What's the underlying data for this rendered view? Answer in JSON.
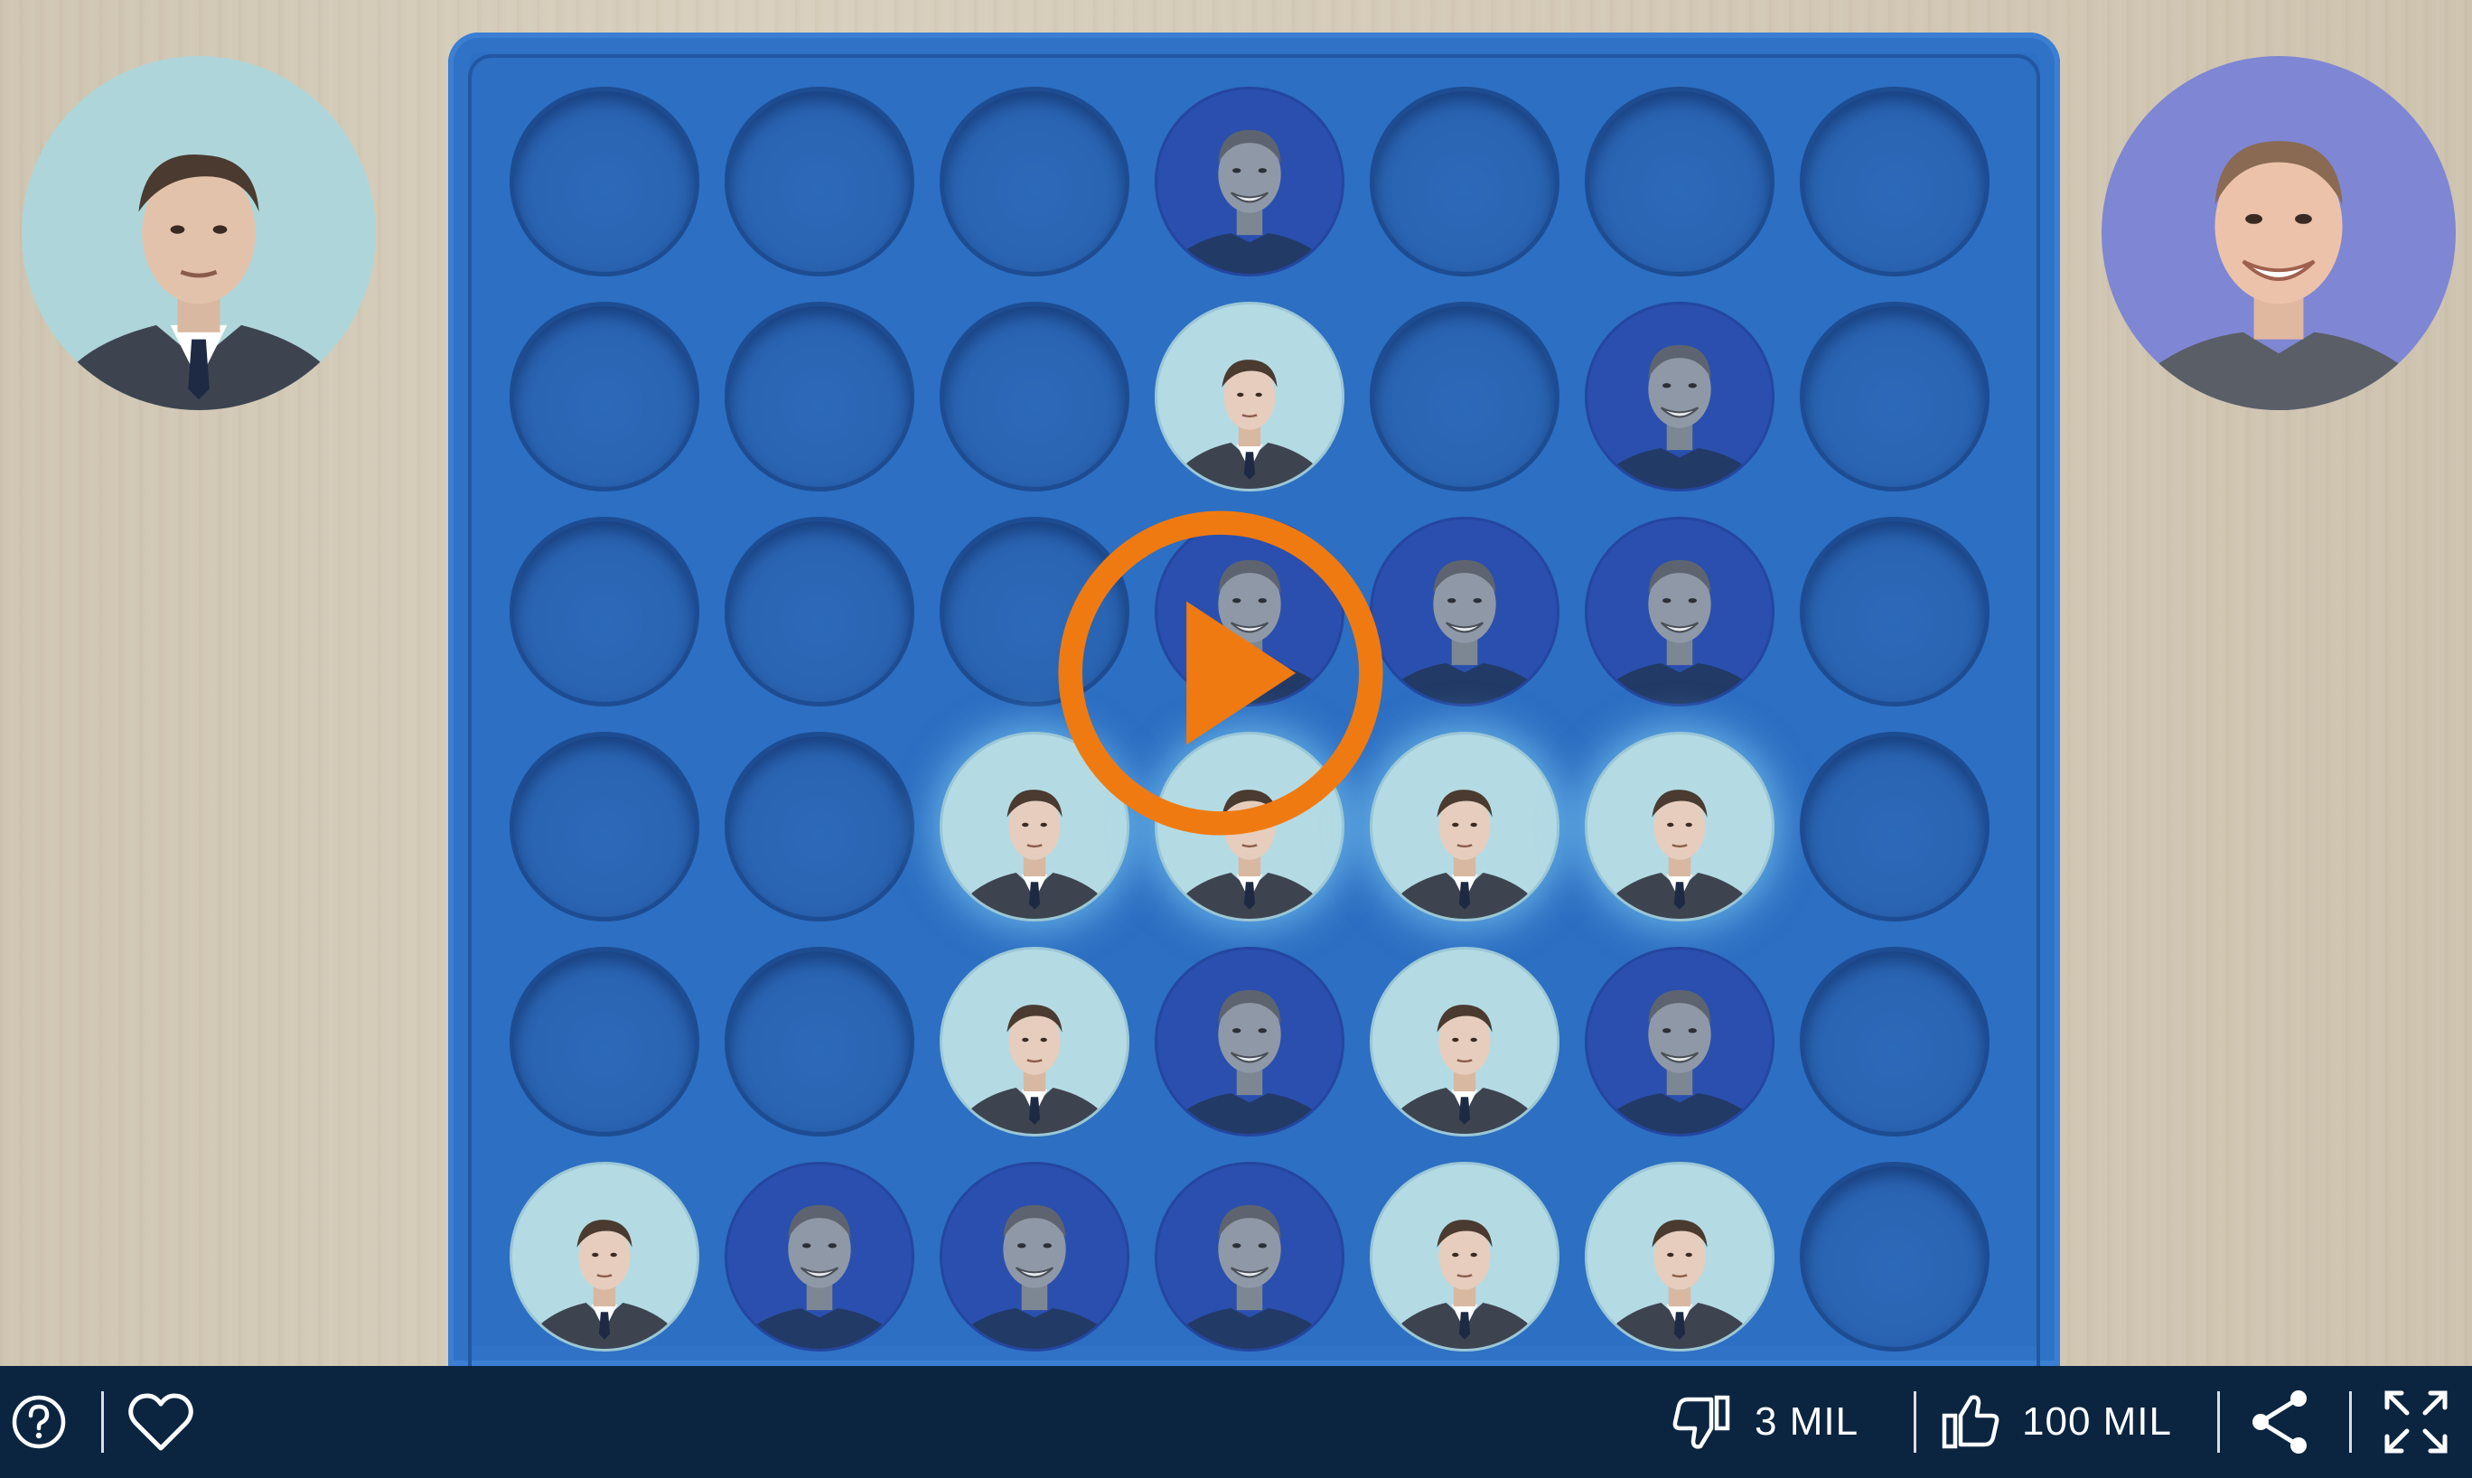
{
  "game": {
    "player_left": "elon",
    "player_right": "mark",
    "rows": 6,
    "cols": 7,
    "board": [
      [
        "empty",
        "empty",
        "empty",
        "mark",
        "empty",
        "empty",
        "empty"
      ],
      [
        "empty",
        "empty",
        "empty",
        "elon",
        "empty",
        "mark",
        "empty"
      ],
      [
        "empty",
        "empty",
        "empty",
        "mark",
        "mark",
        "mark",
        "empty"
      ],
      [
        "empty",
        "empty",
        "elon",
        "elon",
        "elon",
        "elon",
        "empty"
      ],
      [
        "empty",
        "empty",
        "elon",
        "mark",
        "elon",
        "mark",
        "empty"
      ],
      [
        "elon",
        "mark",
        "mark",
        "mark",
        "elon",
        "elon",
        "empty"
      ]
    ],
    "winning_row": 3,
    "winning_cols": [
      2,
      3,
      4,
      5
    ]
  },
  "toolbar": {
    "help_icon": "question-circle-icon",
    "favorite_icon": "heart-icon",
    "dislike_icon": "thumbs-down-icon",
    "dislike_count": "3 MIL",
    "like_icon": "thumbs-up-icon",
    "like_count": "100 MIL",
    "share_icon": "share-icon",
    "fullscreen_icon": "fullscreen-icon"
  },
  "colors": {
    "board": "#2d6fc2",
    "play_button": "#f07a12",
    "toolbar_bg": "#0b2540"
  }
}
